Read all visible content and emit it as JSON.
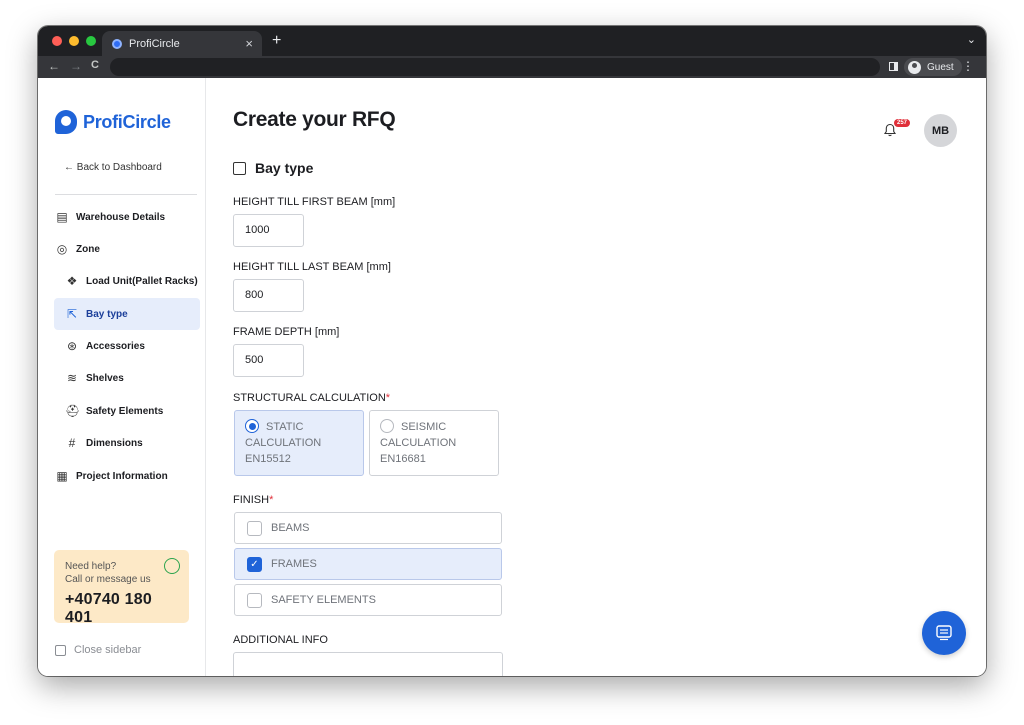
{
  "browser": {
    "tab_title": "ProfiCircle",
    "tab_close": "×",
    "new_tab": "+",
    "tab_menu": "⌄",
    "nav_back": "←",
    "nav_forward": "→",
    "nav_reload": "C",
    "profile_label": "Guest",
    "menu": "⋮"
  },
  "sidebar": {
    "brand": "ProfiCircle",
    "back_link": "← Back to Dashboard",
    "items": [
      {
        "label": "Warehouse Details",
        "icon": "building-icon",
        "glyph": "▤"
      },
      {
        "label": "Zone",
        "icon": "location-pin-icon",
        "glyph": "◎"
      },
      {
        "label": "Load Unit(Pallet Racks)",
        "icon": "boxes-icon",
        "glyph": "❖"
      },
      {
        "label": "Bay type",
        "icon": "expand-square-icon",
        "glyph": "⇱"
      },
      {
        "label": "Accessories",
        "icon": "asterisk-square-icon",
        "glyph": "⊛"
      },
      {
        "label": "Shelves",
        "icon": "layers-icon",
        "glyph": "≋"
      },
      {
        "label": "Safety Elements",
        "icon": "hard-hat-icon",
        "glyph": "⛑"
      },
      {
        "label": "Dimensions",
        "icon": "hash-icon",
        "glyph": "#"
      },
      {
        "label": "Project Information",
        "icon": "document-icon",
        "glyph": "▦"
      }
    ],
    "help": {
      "title": "Need help?",
      "subtitle": "Call or message us",
      "phone": "+40740 180 401"
    },
    "close_sidebar": "Close sidebar"
  },
  "header": {
    "title": "Create your RFQ",
    "notification_count": "257",
    "avatar_initials": "MB"
  },
  "form": {
    "section_title": "Bay type",
    "height_first_beam": {
      "label": "HEIGHT TILL FIRST BEAM [mm]",
      "value": "1000"
    },
    "height_last_beam": {
      "label": "HEIGHT TILL LAST BEAM [mm]",
      "value": "800"
    },
    "frame_depth": {
      "label": "FRAME DEPTH [mm]",
      "value": "500"
    },
    "structural_calc": {
      "label": "STRUCTURAL CALCULATION",
      "required_mark": "*",
      "options": [
        {
          "line1": "STATIC",
          "line2": "CALCULATION",
          "line3": "EN15512",
          "selected": true
        },
        {
          "line1": "SEISMIC",
          "line2": "CALCULATION",
          "line3": "EN16681",
          "selected": false
        }
      ]
    },
    "finish": {
      "label": "FINISH",
      "required_mark": "*",
      "options": [
        {
          "label": "BEAMS",
          "checked": false
        },
        {
          "label": "FRAMES",
          "checked": true
        },
        {
          "label": "SAFETY ELEMENTS",
          "checked": false
        }
      ]
    },
    "additional_info": {
      "label": "ADDITIONAL INFO",
      "value": ""
    }
  },
  "colors": {
    "accent": "#1f63d8",
    "selected_bg": "#e6edfb",
    "help_bg": "#fde9c7",
    "badge": "#e0303a"
  }
}
